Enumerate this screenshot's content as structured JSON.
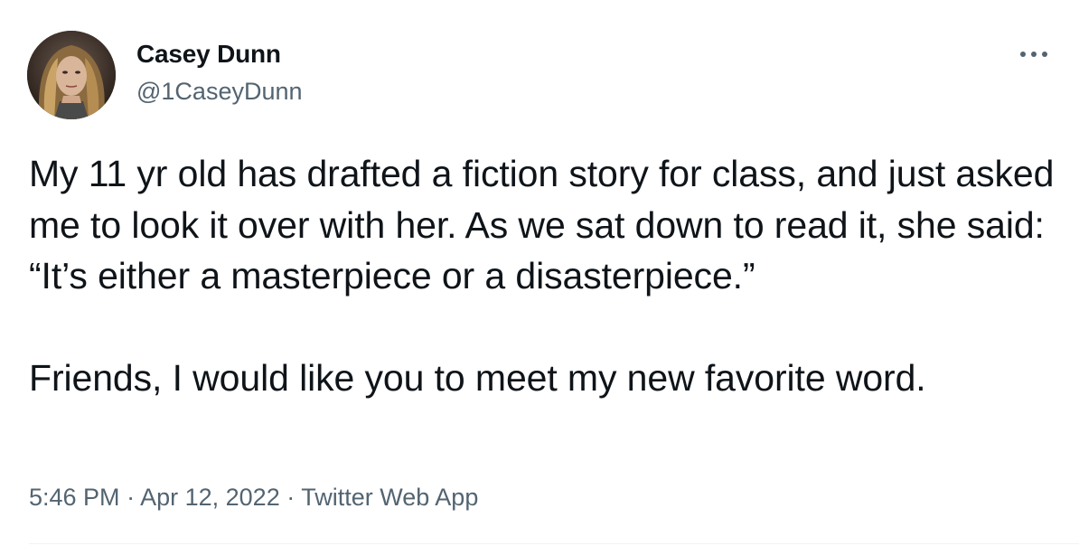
{
  "author": {
    "display_name": "Casey Dunn",
    "handle": "@1CaseyDunn",
    "avatar_icon": "profile-photo"
  },
  "more_icon": "ellipsis-icon",
  "tweet": {
    "paragraph_1": "My 11 yr old has drafted a fiction story for class, and just asked me to look it over with her. As we sat down to read it, she said: “It’s either a masterpiece or a disasterpiece.”",
    "paragraph_2": "Friends, I would like you to meet my new favorite word."
  },
  "meta": {
    "time": "5:46 PM",
    "date": "Apr 12, 2022",
    "source": "Twitter Web App",
    "separator": "·"
  },
  "colors": {
    "text_primary": "#0f1419",
    "text_secondary": "#536471",
    "divider": "#eff3f4"
  }
}
